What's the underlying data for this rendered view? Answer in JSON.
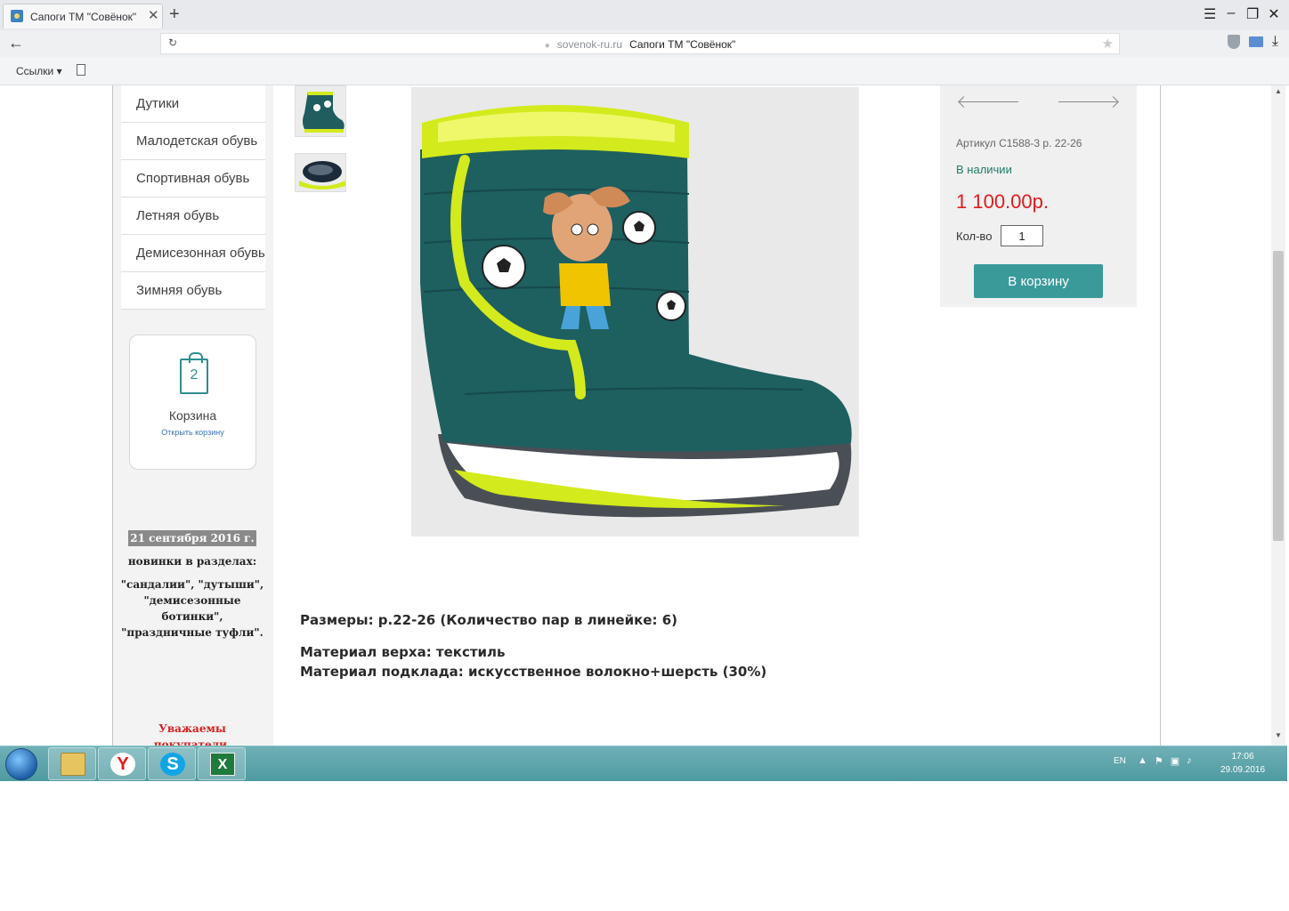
{
  "browser": {
    "tab_title": "Сапоги ТМ \"Совёнок\"",
    "tab_close": "✕",
    "new_tab": "+",
    "url_domain": "sovenok-ru.ru",
    "url_page_title": "Сапоги ТМ \"Совёнок\"",
    "bookmarks_label": "Ссылки ▾"
  },
  "categories": [
    "Дутики",
    "Малодетская обувь",
    "Спортивная обувь",
    "Летняя обувь",
    "Демисезонная обувь",
    "Зимняя обувь"
  ],
  "cart": {
    "count": "2",
    "title": "Корзина",
    "open_link": "Открыть корзину"
  },
  "news": {
    "date": "21 сентября 2016 г.",
    "lead": "новинки в разделах:",
    "line1": "\"сандалии\", \"дутыши\",",
    "line2": "\"демисезонные",
    "line3": "ботинки\",",
    "line4": "\"праздничные туфли\".",
    "warning": "Уважаемы покупатели,"
  },
  "product": {
    "article": "Артикул С1588-3 р. 22-26",
    "stock": "В наличии",
    "price": "1 100.00р.",
    "qty_label": "Кол-во",
    "qty_value": "1",
    "add_to_cart": "В корзину",
    "sizes": "Размеры: р.22-26 (Количество пар в линейке: 6)",
    "material_top": "Материал верха: текстиль",
    "material_lining": "Материал подклада: искусственное волокно+шерсть (30%)"
  },
  "taskbar": {
    "lang": "EN",
    "time": "17:06",
    "date": "29.09.2016"
  },
  "colors": {
    "accent": "#3a9a9a",
    "price": "#e31b1b",
    "stock": "#1f7c69",
    "boot_body": "#1e5f60",
    "boot_trim": "#d3ea1c"
  }
}
